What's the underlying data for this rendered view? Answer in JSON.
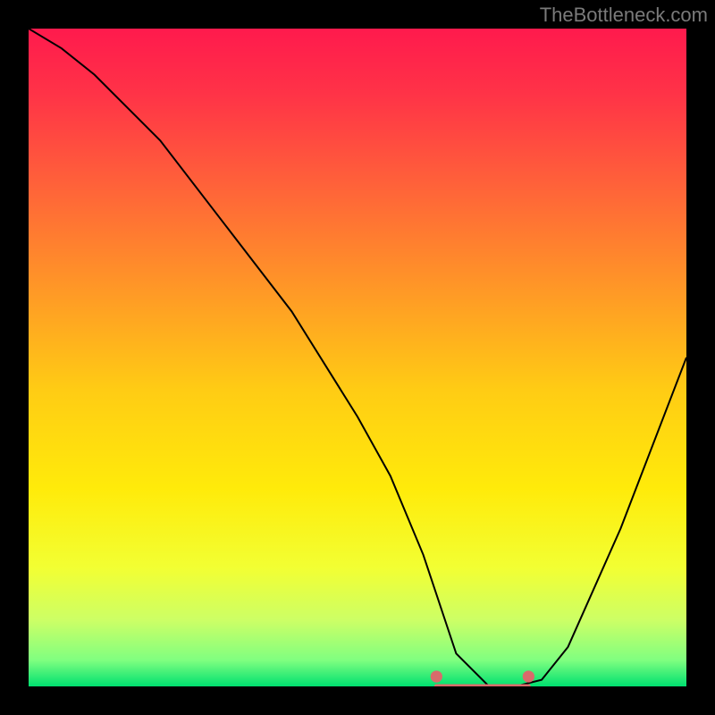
{
  "watermark": "TheBottleneck.com",
  "chart_data": {
    "type": "line",
    "title": "",
    "xlabel": "",
    "ylabel": "",
    "xlim": [
      0,
      100
    ],
    "ylim": [
      0,
      100
    ],
    "series": [
      {
        "name": "bottleneck-curve",
        "x": [
          0,
          5,
          10,
          20,
          30,
          40,
          50,
          55,
          60,
          62,
          65,
          70,
          72,
          74,
          78,
          82,
          90,
          100
        ],
        "values": [
          100,
          97,
          93,
          83,
          70,
          57,
          41,
          32,
          20,
          14,
          5,
          0,
          0,
          0,
          1,
          6,
          24,
          50
        ]
      }
    ],
    "flat_segment": {
      "x_start": 62,
      "x_end": 76,
      "color": "#d96b6b"
    },
    "background_gradient": {
      "stops": [
        {
          "offset": 0.0,
          "color": "#ff1a4d"
        },
        {
          "offset": 0.1,
          "color": "#ff3347"
        },
        {
          "offset": 0.25,
          "color": "#ff6638"
        },
        {
          "offset": 0.4,
          "color": "#ff9926"
        },
        {
          "offset": 0.55,
          "color": "#ffcc14"
        },
        {
          "offset": 0.7,
          "color": "#ffeb0a"
        },
        {
          "offset": 0.82,
          "color": "#f2ff33"
        },
        {
          "offset": 0.9,
          "color": "#ccff66"
        },
        {
          "offset": 0.96,
          "color": "#80ff80"
        },
        {
          "offset": 1.0,
          "color": "#00e070"
        }
      ]
    }
  }
}
